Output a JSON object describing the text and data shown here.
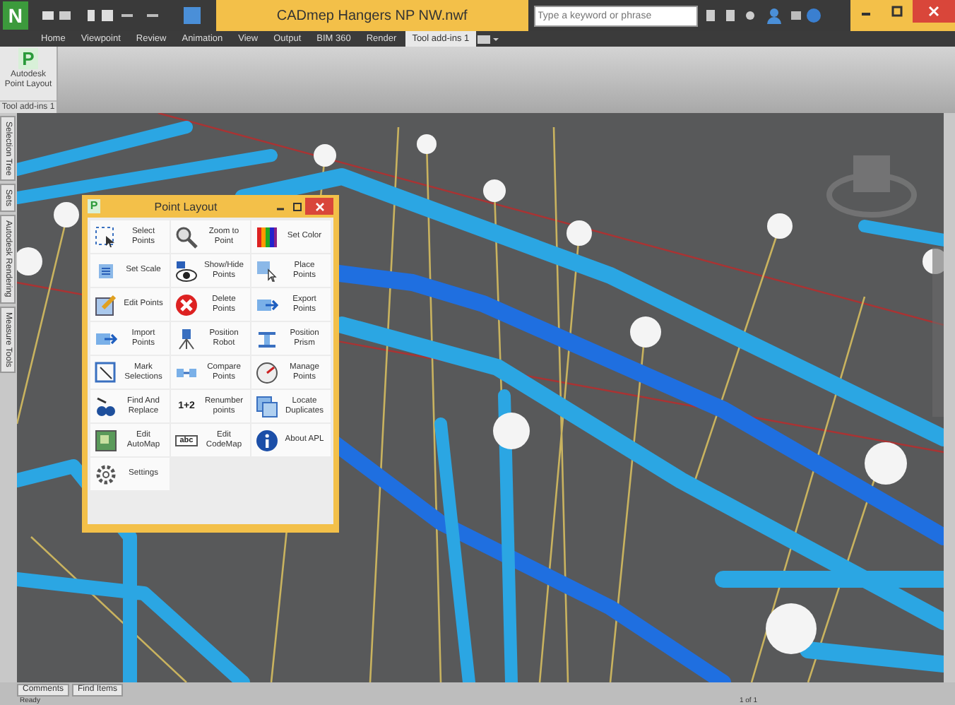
{
  "window": {
    "logo_letter": "N",
    "title": "CADmep Hangers NP NW.nwf",
    "search": {
      "placeholder": "Type a keyword or phrase"
    }
  },
  "tabs": [
    {
      "label": "Home",
      "selected": false
    },
    {
      "label": "Viewpoint",
      "selected": false
    },
    {
      "label": "Review",
      "selected": false
    },
    {
      "label": "Animation",
      "selected": false
    },
    {
      "label": "View",
      "selected": false
    },
    {
      "label": "Output",
      "selected": false
    },
    {
      "label": "BIM 360",
      "selected": false
    },
    {
      "label": "Render",
      "selected": false
    },
    {
      "label": "Tool add-ins 1",
      "selected": true
    }
  ],
  "ribbon": {
    "button": "Autodesk Point Layout",
    "icon_letter": "P",
    "panel": "Tool add-ins 1"
  },
  "side_tabs": [
    "Selection Tree",
    "Sets",
    "Autodesk Rendering",
    "Measure Tools"
  ],
  "dialog": {
    "title": "Point Layout",
    "icon_letter": "P",
    "items": [
      {
        "label": "Select Points",
        "kind": "select"
      },
      {
        "label": "Zoom to Point",
        "kind": "zoom"
      },
      {
        "label": "Set Color",
        "kind": "palette"
      },
      {
        "label": "Set Scale",
        "kind": "scale"
      },
      {
        "label": "Show/Hide Points",
        "kind": "eye"
      },
      {
        "label": "Place Points",
        "kind": "place"
      },
      {
        "label": "Edit Points",
        "kind": "edit"
      },
      {
        "label": "Delete Points",
        "kind": "delete"
      },
      {
        "label": "Export Points",
        "kind": "export"
      },
      {
        "label": "Import Points",
        "kind": "import"
      },
      {
        "label": "Position Robot",
        "kind": "robot"
      },
      {
        "label": "Position Prism",
        "kind": "prism"
      },
      {
        "label": "Mark Selections",
        "kind": "mark"
      },
      {
        "label": "Compare Points",
        "kind": "compare"
      },
      {
        "label": "Manage Points",
        "kind": "gauge"
      },
      {
        "label": "Find And Replace",
        "kind": "find"
      },
      {
        "label": "Renumber points",
        "kind": "text",
        "icon_text": "1+2"
      },
      {
        "label": "Locate Duplicates",
        "kind": "duplicates"
      },
      {
        "label": "Edit AutoMap",
        "kind": "map"
      },
      {
        "label": "Edit CodeMap",
        "kind": "code",
        "icon_text": "abc"
      },
      {
        "label": "About APL",
        "kind": "info"
      },
      {
        "label": "Settings",
        "kind": "gear"
      }
    ]
  },
  "bottom_tabs": [
    "Comments",
    "Find Items"
  ],
  "status_bar": {
    "text": "Ready",
    "page": "1 of 1"
  }
}
